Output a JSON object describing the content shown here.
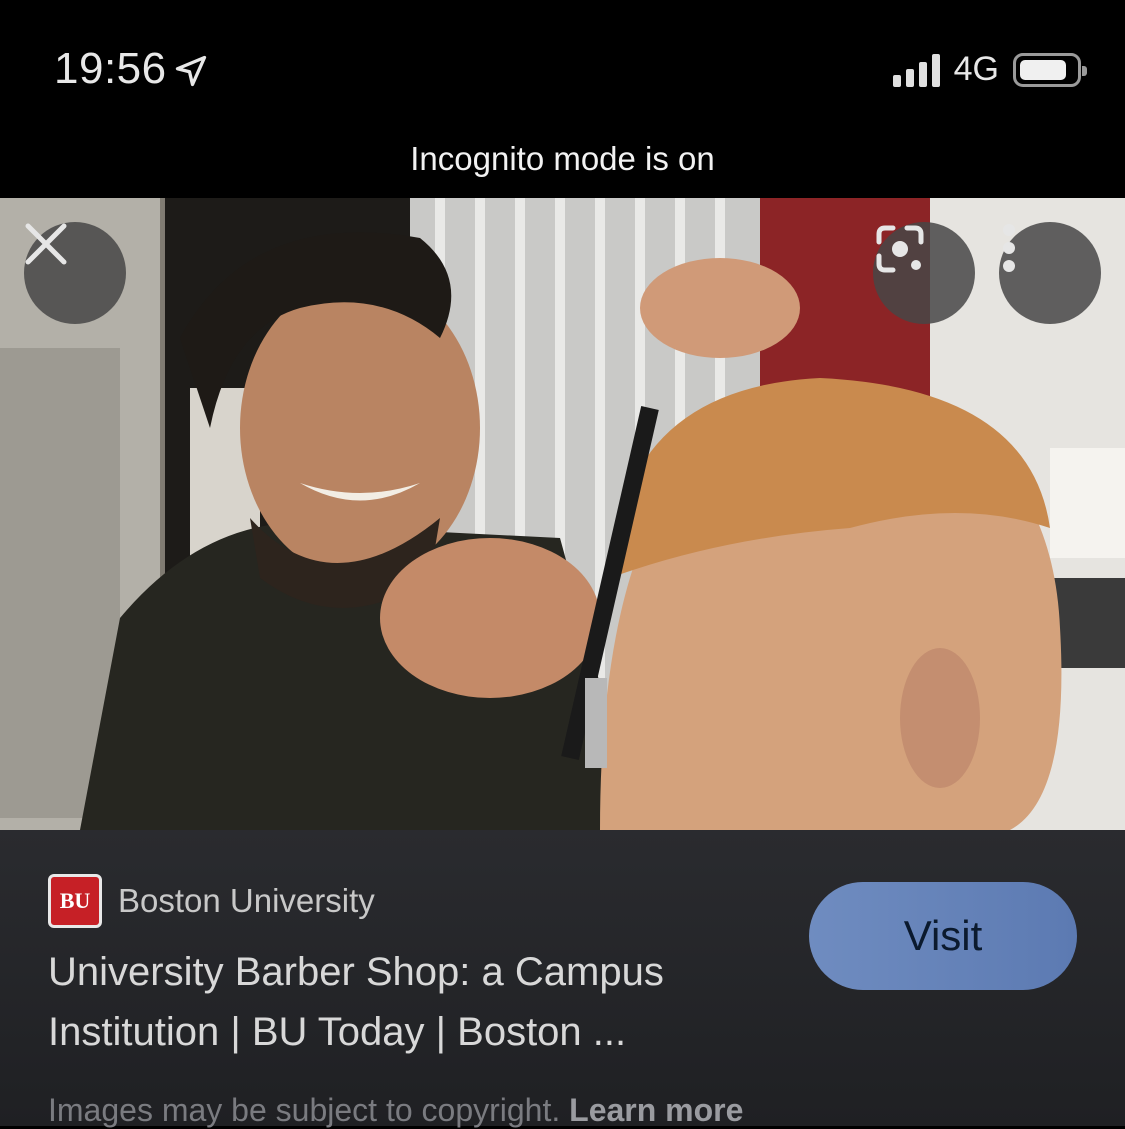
{
  "status_bar": {
    "time": "19:56",
    "network": "4G"
  },
  "banner": {
    "text": "Incognito mode is on"
  },
  "image": {
    "description_alt": ""
  },
  "controls": {
    "close_icon": "close-icon",
    "lens_icon": "lens-icon",
    "more_icon": "more-vert-icon"
  },
  "result": {
    "source": "Boston University",
    "favicon_text": "BU",
    "title": "University Barber Shop: a Campus Institution | BU Today | Boston ...",
    "visit_label": "Visit",
    "copyright_text": "Images may be subject to copyright.",
    "learn_more": "Learn more"
  },
  "colors": {
    "visit_button": "#6f8cc0",
    "favicon": "#c62026",
    "panel": "#2a2b2f"
  }
}
